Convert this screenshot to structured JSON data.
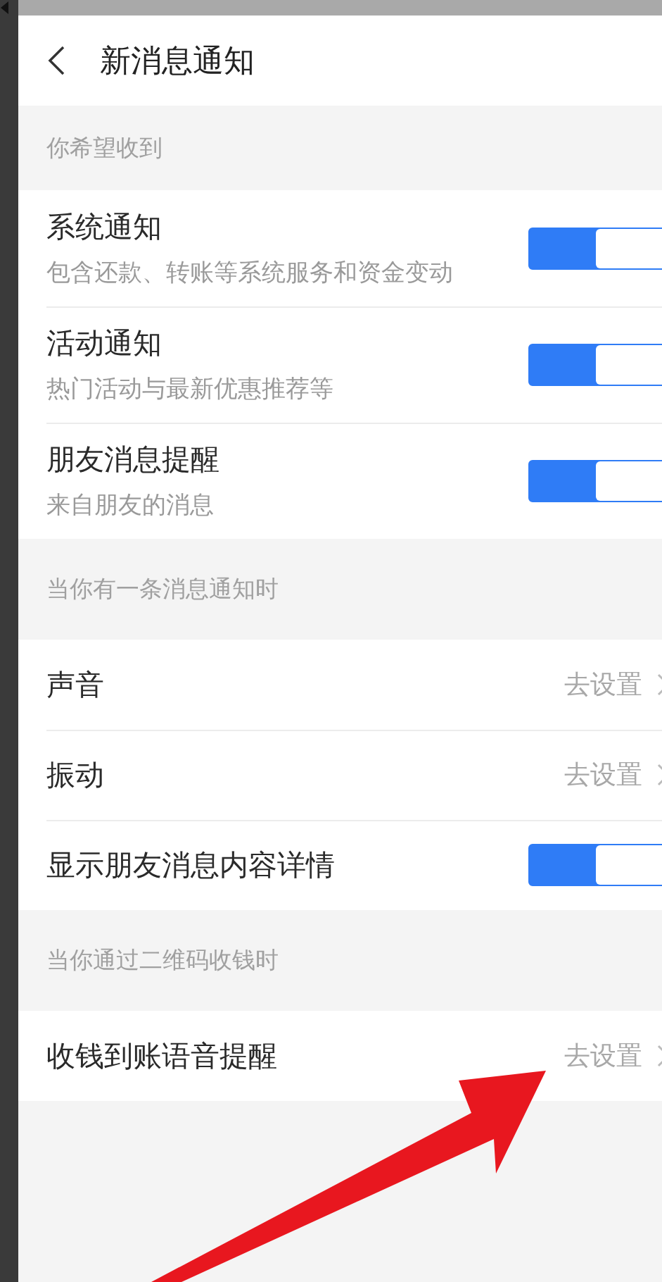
{
  "header": {
    "title": "新消息通知"
  },
  "sections": [
    {
      "header": "你希望收到",
      "items": [
        {
          "kind": "toggle",
          "title": "系统通知",
          "subtitle": "包含还款、转账等系统服务和资金变动",
          "on": true
        },
        {
          "kind": "toggle",
          "title": "活动通知",
          "subtitle": "热门活动与最新优惠推荐等",
          "on": true
        },
        {
          "kind": "toggle",
          "title": "朋友消息提醒",
          "subtitle": "来自朋友的消息",
          "on": true
        }
      ]
    },
    {
      "header": "当你有一条消息通知时",
      "items": [
        {
          "kind": "link",
          "title": "声音",
          "action": "去设置"
        },
        {
          "kind": "link",
          "title": "振动",
          "action": "去设置"
        },
        {
          "kind": "toggle",
          "title": "显示朋友消息内容详情",
          "on": true
        }
      ]
    },
    {
      "header": "当你通过二维码收钱时",
      "items": [
        {
          "kind": "link",
          "title": "收钱到账语音提醒",
          "action": "去设置"
        }
      ]
    }
  ]
}
